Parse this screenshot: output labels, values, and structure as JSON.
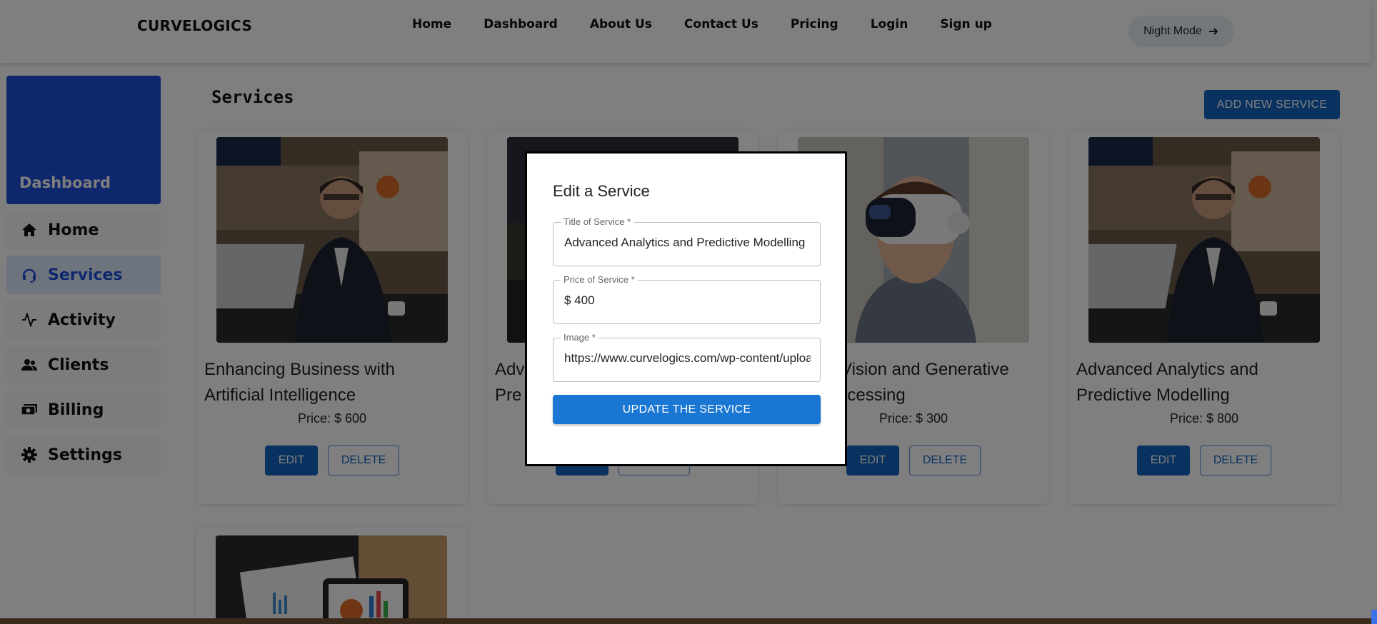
{
  "header": {
    "brand": "CURVELOGICS",
    "nav": [
      "Home",
      "Dashboard",
      "About Us",
      "Contact Us",
      "Pricing",
      "Login",
      "Sign up"
    ],
    "night_mode_label": "Night Mode"
  },
  "sidebar": {
    "dashboard_label": "Dashboard",
    "items": [
      {
        "label": "Home",
        "icon": "home-icon"
      },
      {
        "label": "Services",
        "icon": "headset-icon",
        "active": true
      },
      {
        "label": "Activity",
        "icon": "activity-icon"
      },
      {
        "label": "Clients",
        "icon": "people-icon"
      },
      {
        "label": "Billing",
        "icon": "money-icon"
      },
      {
        "label": "Settings",
        "icon": "gear-icon"
      }
    ]
  },
  "main": {
    "title": "Services",
    "add_button": "ADD NEW SERVICE",
    "cards": [
      {
        "title": "Enhancing Business with Artificial Intelligence",
        "price": "Price: $ 600",
        "edit": "EDIT",
        "delete": "DELETE"
      },
      {
        "title": "Adv... Pre...",
        "price": "",
        "edit": "",
        "delete": ""
      },
      {
        "title": "...er Vision and Generative ...Processing",
        "price": "Price: $ 300",
        "edit": "EDIT",
        "delete": "DELETE"
      },
      {
        "title": "Advanced Analytics and Predictive Modelling",
        "price": "Price: $ 800",
        "edit": "EDIT",
        "delete": "DELETE"
      }
    ],
    "card1_title": "Enhancing Business with Artificial Intelligence",
    "card2_title_a": "Adv",
    "card2_title_b": "Pre",
    "card3_title_a": "er Vision and Generative",
    "card3_title_b": "Processing",
    "card4_title": "Advanced Analytics and Predictive Modelling"
  },
  "modal": {
    "title": "Edit a Service",
    "fields": {
      "title_label": "Title of Service *",
      "title_value": "Advanced Analytics and Predictive Modelling",
      "price_label": "Price of Service *",
      "price_value": "$ 400",
      "image_label": "Image *",
      "image_value": "https://www.curvelogics.com/wp-content/uploads"
    },
    "submit_label": "UPDATE THE SERVICE"
  }
}
